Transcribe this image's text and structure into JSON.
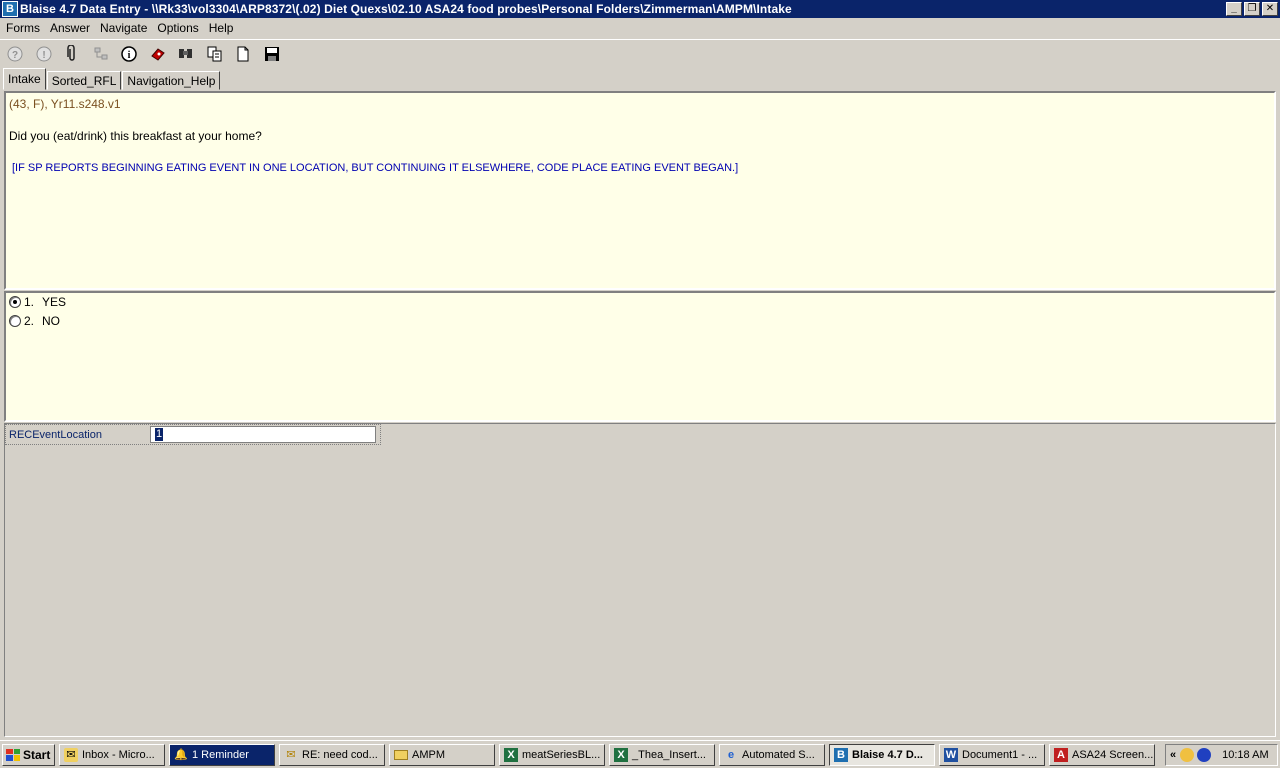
{
  "window": {
    "title": "Blaise 4.7 Data Entry - \\\\Rk33\\vol3304\\ARP8372\\(.02) Diet Quexs\\02.10 ASA24 food probes\\Personal Folders\\Zimmerman\\AMPM\\Intake",
    "minimize": "_",
    "restore": "❐",
    "close": "✕"
  },
  "menu": [
    "Forms",
    "Answer",
    "Navigate",
    "Options",
    "Help"
  ],
  "toolbar": [
    "help-icon",
    "remark-icon",
    "attachment-icon",
    "network-icon",
    "info-icon",
    "watch-icon",
    "find-icon",
    "copy-icon",
    "new-form-icon",
    "save-icon"
  ],
  "tabs": [
    "Intake",
    "Sorted_RFL",
    "Navigation_Help"
  ],
  "question": {
    "meta": "(43, F),   Yr11.s248.v1",
    "text": "Did you (eat/drink) this breakfast at your home?",
    "instruction": "[IF SP REPORTS BEGINNING EATING EVENT IN ONE LOCATION, BUT CONTINUING IT ELSEWHERE, CODE PLACE EATING EVENT BEGAN.]"
  },
  "options": [
    {
      "num": "1.",
      "label": "YES",
      "selected": true
    },
    {
      "num": "2.",
      "label": "NO",
      "selected": false
    }
  ],
  "field": {
    "label": "RECEventLocation",
    "value": "1"
  },
  "taskbar": {
    "start": "Start",
    "items": [
      {
        "label": "Inbox - Micro...",
        "icon": "outlook-icon"
      },
      {
        "label": "1 Reminder",
        "icon": "bell-icon"
      },
      {
        "label": "RE: need cod...",
        "icon": "mail-icon"
      },
      {
        "label": "AMPM",
        "icon": "folder-icon"
      },
      {
        "label": "meatSeriesBL...",
        "icon": "excel-icon"
      },
      {
        "label": "_Thea_Insert...",
        "icon": "excel-icon"
      },
      {
        "label": "Automated S...",
        "icon": "ie-icon"
      },
      {
        "label": "Blaise 4.7 D...",
        "icon": "blaise-icon"
      },
      {
        "label": "Document1 - ...",
        "icon": "word-icon"
      },
      {
        "label": "ASA24 Screen...",
        "icon": "pdf-icon"
      }
    ],
    "tray_chevron": "«",
    "clock": "10:18 AM"
  },
  "colors": {
    "titlebar": "#0a246a",
    "panel_bg": "#ffffe8",
    "meta_text": "#7a5020",
    "instruction_text": "#0000b0"
  }
}
